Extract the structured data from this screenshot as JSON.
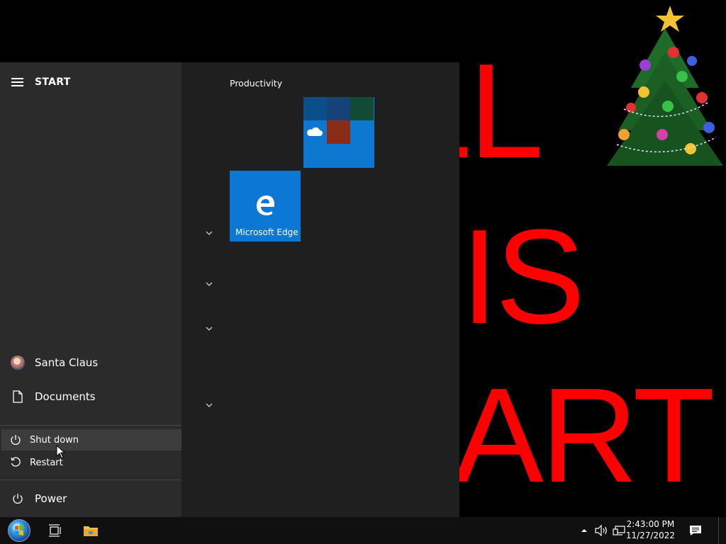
{
  "wallpaper": {
    "lines": [
      "SMALL",
      "IS",
      "ART"
    ],
    "text_color": "#ff0000"
  },
  "start_menu": {
    "title": "START",
    "user": {
      "label": "Santa Claus"
    },
    "documents": {
      "label": "Documents"
    },
    "power": {
      "label": "Power"
    },
    "power_flyout": [
      {
        "label": "Shut down",
        "icon": "power-icon",
        "hovered": true
      },
      {
        "label": "Restart",
        "icon": "restart-icon",
        "hovered": false
      }
    ],
    "tile_group": {
      "label": "Productivity",
      "tiles": [
        {
          "name": "",
          "type": "folder"
        },
        {
          "name": "Microsoft Edge",
          "icon": "edge-icon"
        }
      ]
    }
  },
  "taskbar": {
    "time": "2:43:00 PM",
    "date": "11/27/2022",
    "pinned": [
      "start-orb",
      "task-view-icon",
      "file-explorer-icon"
    ],
    "tray": [
      "chevron-up-icon",
      "volume-icon",
      "network-icon",
      "notification-icon"
    ]
  },
  "colors": {
    "accent": "#0a78d4",
    "menu_left_bg": "#2b2b2b",
    "menu_right_bg": "#1f1f1f",
    "taskbar_bg": "#101010"
  }
}
